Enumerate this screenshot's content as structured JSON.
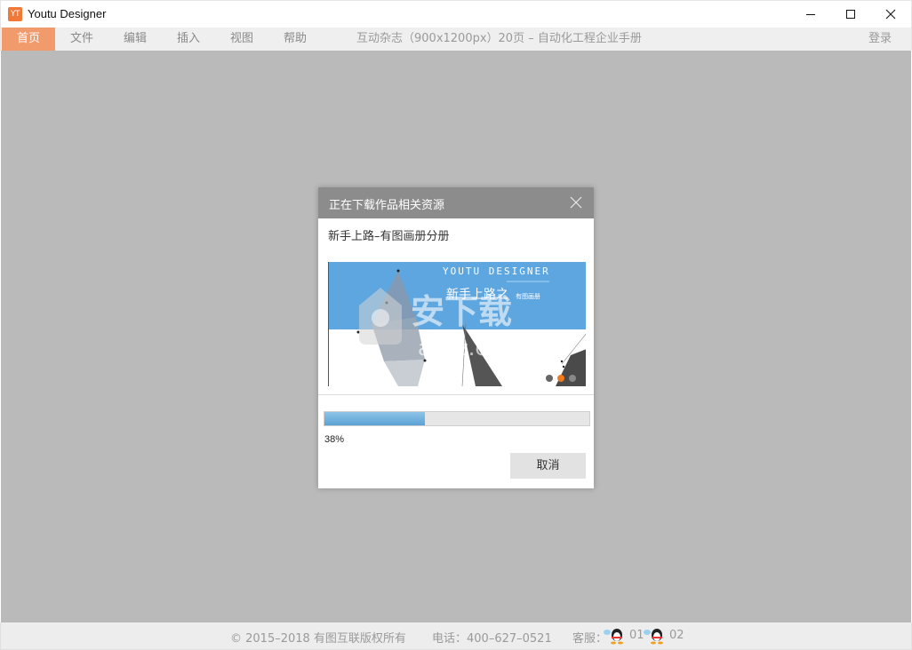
{
  "window": {
    "logo_text": "YT",
    "title": "Youtu Designer",
    "controls": [
      "minimize-icon",
      "maximize-icon",
      "close-icon"
    ]
  },
  "menu": {
    "items": [
      {
        "label": "首页",
        "active": true
      },
      {
        "label": "文件",
        "active": false
      },
      {
        "label": "编辑",
        "active": false
      },
      {
        "label": "插入",
        "active": false
      },
      {
        "label": "视图",
        "active": false
      },
      {
        "label": "帮助",
        "active": false
      }
    ],
    "document_title": "互动杂志（900x1200px）20页 – 自动化工程企业手册",
    "login": "登录",
    "active_color": "#f19a6c"
  },
  "dialog": {
    "title": "正在下载作品相关资源",
    "item_name": "新手上路–有图画册分册",
    "preview": {
      "brand_text": "YOUTU DESIGNER",
      "headline": "新手上路之",
      "subline": "有图画册"
    },
    "progress": {
      "fraction": 0.38,
      "text": "38%"
    },
    "cancel_label": "取消"
  },
  "footer": {
    "copyright": "© 2015–2018 有图互联版权所有",
    "phone": "电话：400–627–0521",
    "service_label": "客服：",
    "qq1": "01",
    "qq2": "02"
  },
  "colors": {
    "workspace": "#bababa",
    "dialog_header": "#8c8c8c",
    "preview_blue": "#5ea6e0",
    "progress": "#5aa3d6"
  }
}
